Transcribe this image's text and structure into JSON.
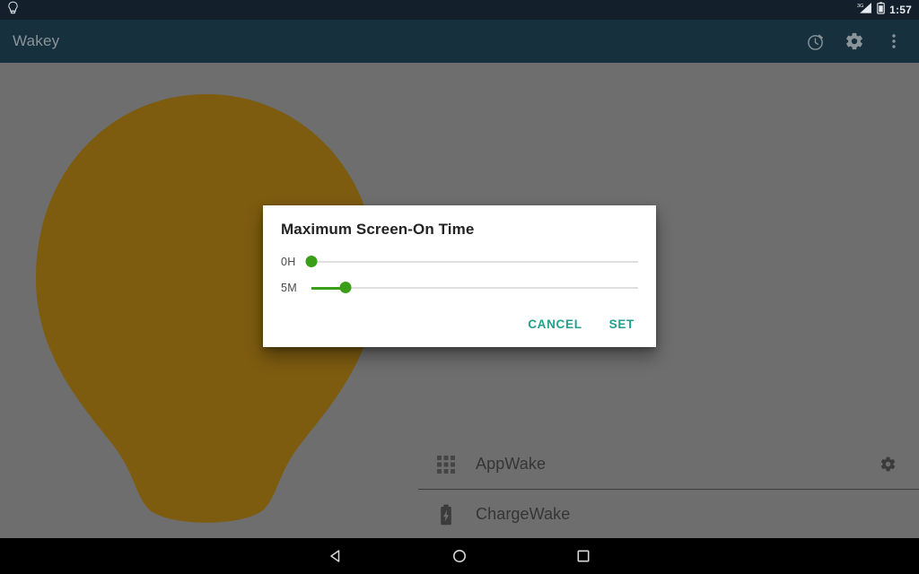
{
  "status_bar": {
    "notification_icon": "lightbulb-icon",
    "signal_icon": "signal-3g-icon",
    "signal_label": "3G",
    "battery_icon": "battery-icon",
    "clock": "1:57",
    "background_color": "#13202b"
  },
  "app_bar": {
    "title": "Wakey",
    "background_color": "#16303d",
    "title_color": "#8a9499",
    "actions": [
      {
        "name": "timer-icon",
        "label": "Timer"
      },
      {
        "name": "gear-icon",
        "label": "Settings"
      },
      {
        "name": "overflow-menu-icon",
        "label": "More options"
      }
    ]
  },
  "content": {
    "background_color": "#6e6e6e",
    "bulb_color": "#7d5c10",
    "bulb_icon": "lightbulb-illustration"
  },
  "wake_list": {
    "items": [
      {
        "label": "AppWake",
        "icon": "apps-grid-icon",
        "action_icon": "gear-icon",
        "has_action": true,
        "has_divider": true
      },
      {
        "label": "ChargeWake",
        "icon": "battery-charging-icon",
        "action_icon": "",
        "has_action": false,
        "has_divider": false
      }
    ]
  },
  "dialog": {
    "title": "Maximum Screen-On Time",
    "accent_color": "#23a08c",
    "slider_color": "#3a9e18",
    "sliders": [
      {
        "label": "0H",
        "value": 0,
        "min": 0,
        "max": 100,
        "unit": "H",
        "percent": 0
      },
      {
        "label": "5M",
        "value": 5,
        "min": 0,
        "max": 60,
        "unit": "M",
        "percent": 10.5
      }
    ],
    "buttons": {
      "cancel": "CANCEL",
      "set": "SET"
    }
  },
  "nav_bar": {
    "background_color": "#000000",
    "buttons": [
      {
        "name": "back-button",
        "label": "Back"
      },
      {
        "name": "home-button",
        "label": "Home"
      },
      {
        "name": "recents-button",
        "label": "Recents"
      }
    ]
  }
}
